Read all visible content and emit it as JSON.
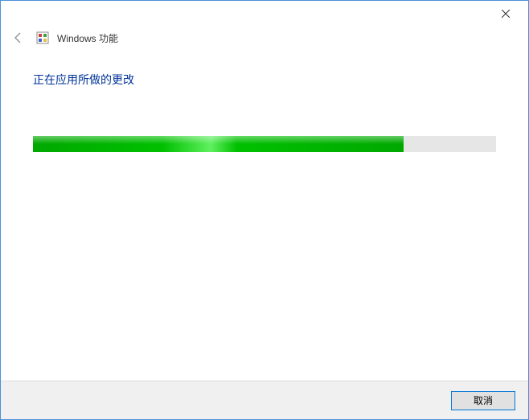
{
  "titlebar": {
    "close_label": "×"
  },
  "header": {
    "window_title": "Windows 功能"
  },
  "content": {
    "heading": "正在应用所做的更改",
    "progress_percent": 80
  },
  "footer": {
    "cancel_label": "取消"
  }
}
